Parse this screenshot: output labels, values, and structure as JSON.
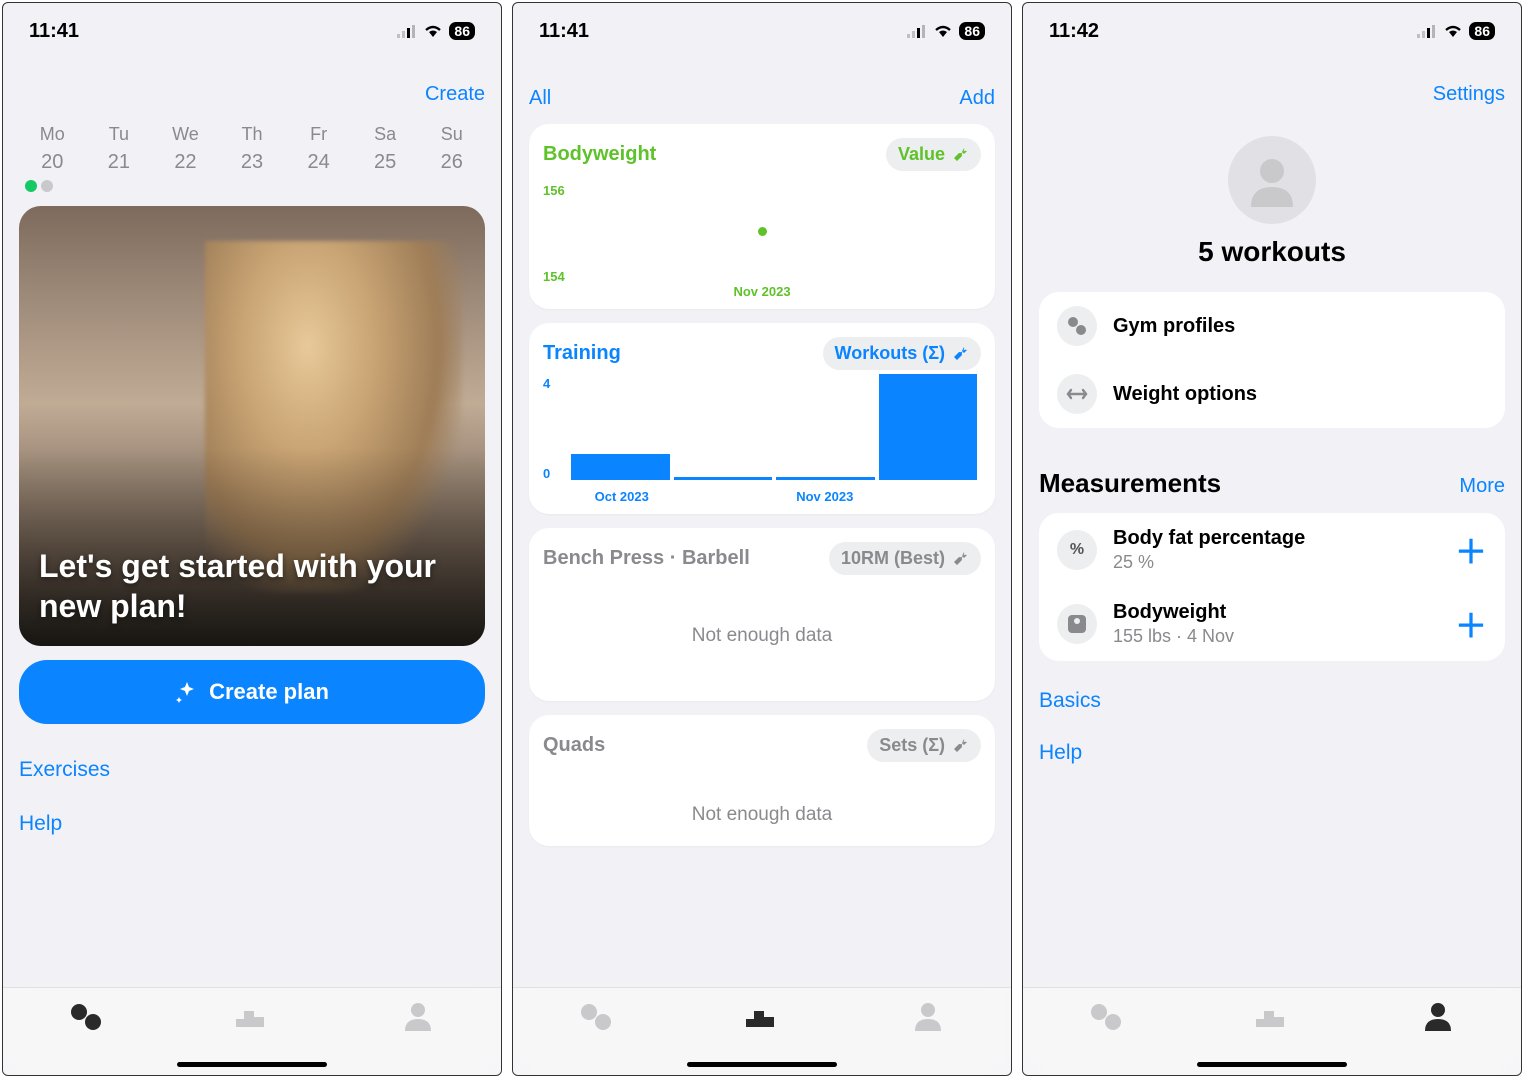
{
  "screen1": {
    "status": {
      "time": "11:41",
      "battery": "86"
    },
    "create_label": "Create",
    "week": [
      {
        "d": "Mo",
        "n": "20"
      },
      {
        "d": "Tu",
        "n": "21"
      },
      {
        "d": "We",
        "n": "22"
      },
      {
        "d": "Th",
        "n": "23"
      },
      {
        "d": "Fr",
        "n": "24"
      },
      {
        "d": "Sa",
        "n": "25"
      },
      {
        "d": "Su",
        "n": "26"
      }
    ],
    "dot_colors": [
      "#17c964",
      "#c9c9cc"
    ],
    "hero_text": "Let's get started with your new plan!",
    "create_plan_label": "Create plan",
    "exercises_label": "Exercises",
    "help_label": "Help"
  },
  "screen2": {
    "status": {
      "time": "11:41",
      "battery": "86"
    },
    "all_label": "All",
    "add_label": "Add",
    "cards": {
      "bodyweight": {
        "title": "Bodyweight",
        "chip": "Value",
        "color": "#5fc22a",
        "y_top": "156",
        "y_bot": "154",
        "x_label": "Nov 2023"
      },
      "training": {
        "title": "Training",
        "chip": "Workouts (Σ)",
        "color": "#0b84ff",
        "y_top": "4",
        "y_bot": "0",
        "x_labels": [
          "Oct 2023",
          "",
          "Nov 2023",
          ""
        ]
      },
      "bench": {
        "title": "Bench Press · Barbell",
        "chip": "10RM (Best)",
        "msg": "Not enough data"
      },
      "quads": {
        "title": "Quads",
        "chip": "Sets (Σ)",
        "msg": "Not enough data"
      }
    }
  },
  "screen3": {
    "status": {
      "time": "11:42",
      "battery": "86"
    },
    "settings_label": "Settings",
    "workout_count": "5 workouts",
    "rows": {
      "gym": "Gym profiles",
      "weight": "Weight options"
    },
    "measurements_title": "Measurements",
    "more_label": "More",
    "measurements": {
      "bfp": {
        "title": "Body fat percentage",
        "sub": "25 %"
      },
      "bw": {
        "title": "Bodyweight",
        "sub": "155 lbs · 4 Nov"
      }
    },
    "basics_label": "Basics",
    "help_label": "Help"
  },
  "chart_data": [
    {
      "type": "scatter",
      "title": "Bodyweight",
      "series_label": "Value",
      "x": [
        "Nov 2023"
      ],
      "y": [
        155
      ],
      "ylim": [
        154,
        156
      ],
      "xlabel": "",
      "ylabel": ""
    },
    {
      "type": "bar",
      "title": "Training",
      "series_label": "Workouts (Σ)",
      "categories": [
        "Oct 2023",
        "",
        "Nov 2023",
        ""
      ],
      "values": [
        1,
        0.1,
        0.1,
        4
      ],
      "ylim": [
        0,
        4
      ],
      "xlabel": "",
      "ylabel": ""
    }
  ]
}
